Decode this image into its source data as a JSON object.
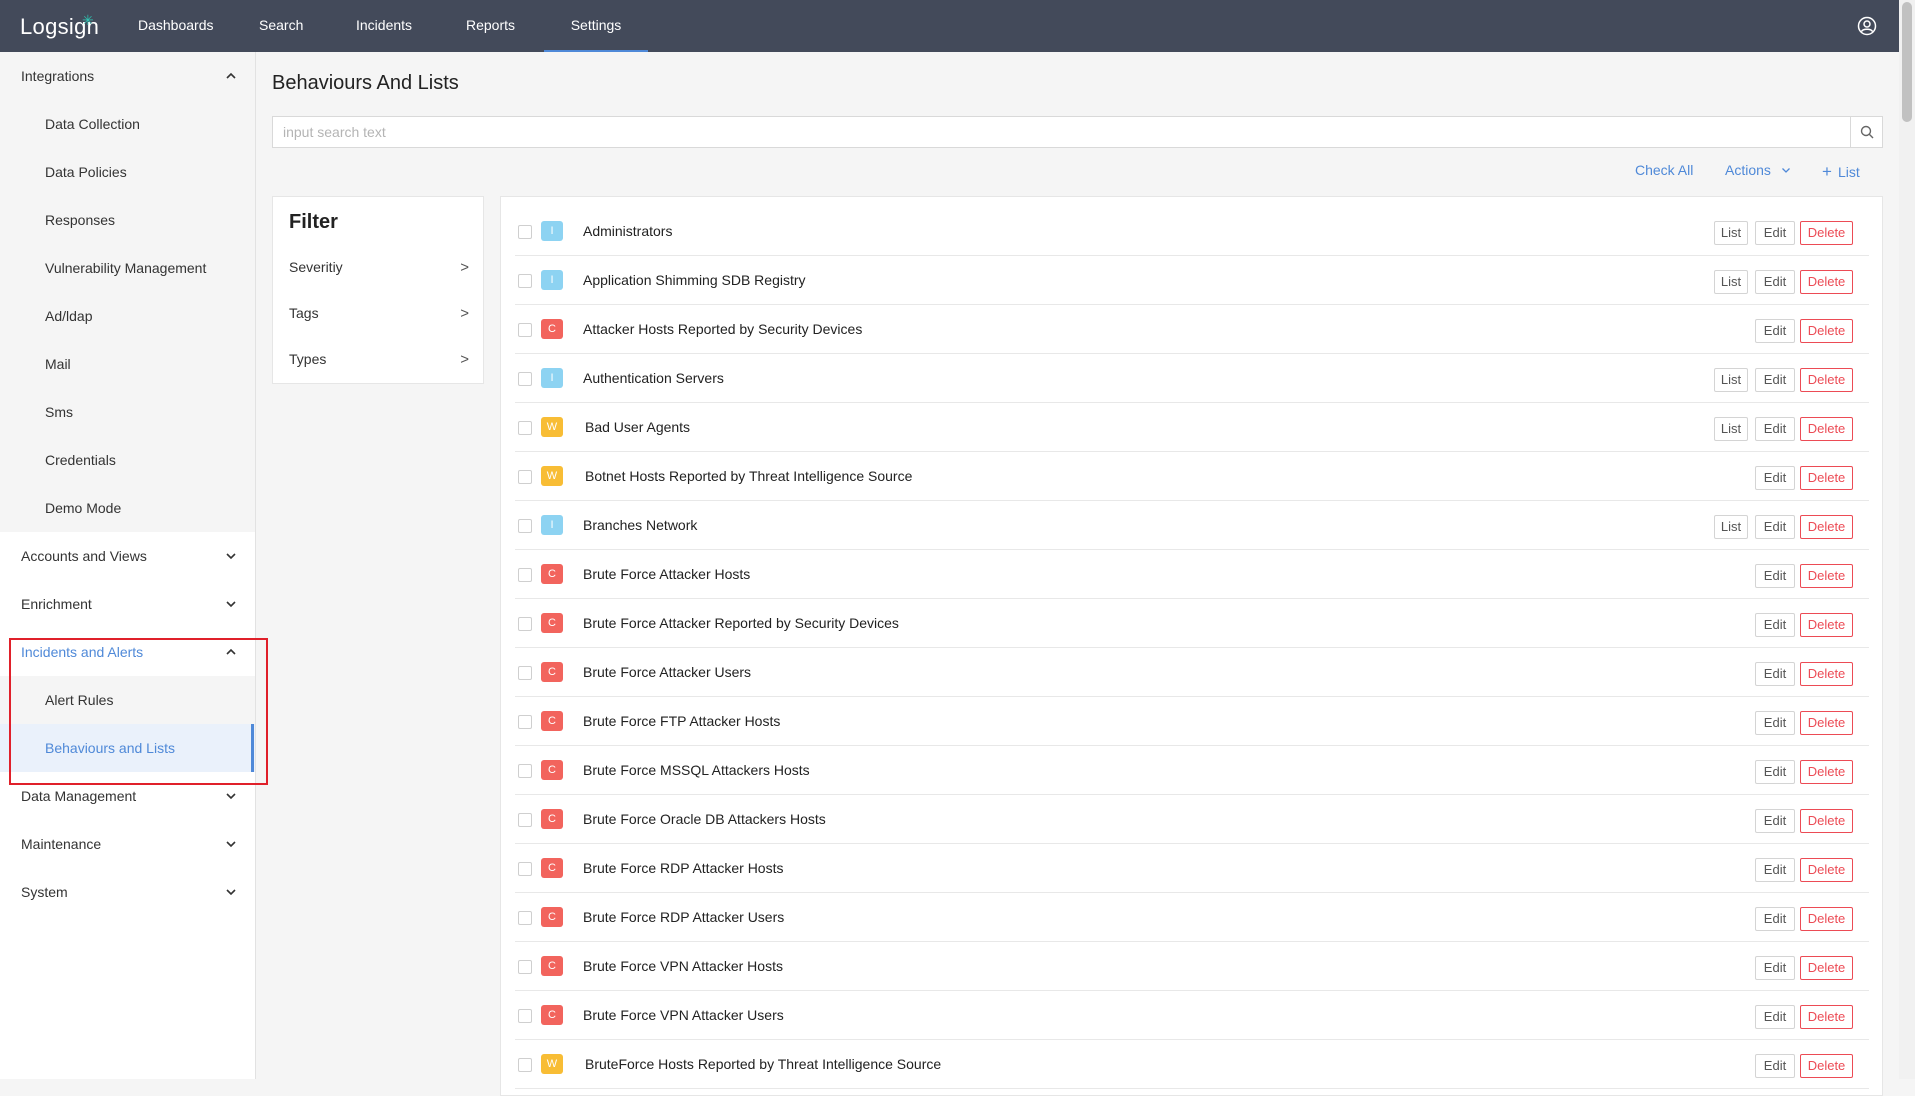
{
  "app": {
    "logo": "Logsign"
  },
  "nav": {
    "items": [
      {
        "label": "Dashboards",
        "active": false
      },
      {
        "label": "Search",
        "active": false
      },
      {
        "label": "Incidents",
        "active": false
      },
      {
        "label": "Reports",
        "active": false
      },
      {
        "label": "Settings",
        "active": true
      }
    ]
  },
  "sidebar": {
    "integrations": {
      "label": "Integrations",
      "items": [
        "Data Collection",
        "Data Policies",
        "Responses",
        "Vulnerability Management",
        "Ad/ldap",
        "Mail",
        "Sms",
        "Credentials",
        "Demo Mode"
      ]
    },
    "accounts": {
      "label": "Accounts and Views"
    },
    "enrichment": {
      "label": "Enrichment"
    },
    "incidents": {
      "label": "Incidents and Alerts",
      "items": [
        "Alert Rules",
        "Behaviours and Lists"
      ],
      "selected": "Behaviours and Lists"
    },
    "data_management": {
      "label": "Data Management"
    },
    "maintenance": {
      "label": "Maintenance"
    },
    "system": {
      "label": "System"
    }
  },
  "main": {
    "title": "Behaviours And Lists",
    "search": {
      "placeholder": "input search text",
      "value": ""
    },
    "toolbar": {
      "check_all": "Check All",
      "actions": "Actions",
      "add_list": "List"
    }
  },
  "filter": {
    "title": "Filter",
    "items": [
      "Severitiy",
      "Tags",
      "Types"
    ]
  },
  "buttons": {
    "list": "List",
    "edit": "Edit",
    "delete": "Delete"
  },
  "colors": {
    "accent": "#4f89d8",
    "info": "#8dd3f2",
    "critical": "#f2645d",
    "warning": "#f8bd35",
    "danger": "#ec4b55"
  },
  "rows": [
    {
      "sev": "I",
      "name": "Administrators",
      "has_list": true
    },
    {
      "sev": "I",
      "name": "Application Shimming SDB Registry",
      "has_list": true
    },
    {
      "sev": "C",
      "name": "Attacker Hosts Reported by Security Devices",
      "has_list": false
    },
    {
      "sev": "I",
      "name": "Authentication Servers",
      "has_list": true
    },
    {
      "sev": "W",
      "name": "Bad User Agents",
      "has_list": true
    },
    {
      "sev": "W",
      "name": "Botnet Hosts Reported by Threat Intelligence Source",
      "has_list": false
    },
    {
      "sev": "I",
      "name": "Branches Network",
      "has_list": true
    },
    {
      "sev": "C",
      "name": "Brute Force Attacker Hosts",
      "has_list": false
    },
    {
      "sev": "C",
      "name": "Brute Force Attacker Reported by Security Devices",
      "has_list": false
    },
    {
      "sev": "C",
      "name": "Brute Force Attacker Users",
      "has_list": false
    },
    {
      "sev": "C",
      "name": "Brute Force FTP Attacker Hosts",
      "has_list": false
    },
    {
      "sev": "C",
      "name": "Brute Force MSSQL Attackers Hosts",
      "has_list": false
    },
    {
      "sev": "C",
      "name": "Brute Force Oracle DB Attackers Hosts",
      "has_list": false
    },
    {
      "sev": "C",
      "name": "Brute Force RDP Attacker Hosts",
      "has_list": false
    },
    {
      "sev": "C",
      "name": "Brute Force RDP Attacker Users",
      "has_list": false
    },
    {
      "sev": "C",
      "name": "Brute Force VPN Attacker Hosts",
      "has_list": false
    },
    {
      "sev": "C",
      "name": "Brute Force VPN Attacker Users",
      "has_list": false
    },
    {
      "sev": "W",
      "name": "BruteForce Hosts Reported by Threat Intelligence Source",
      "has_list": false
    }
  ]
}
